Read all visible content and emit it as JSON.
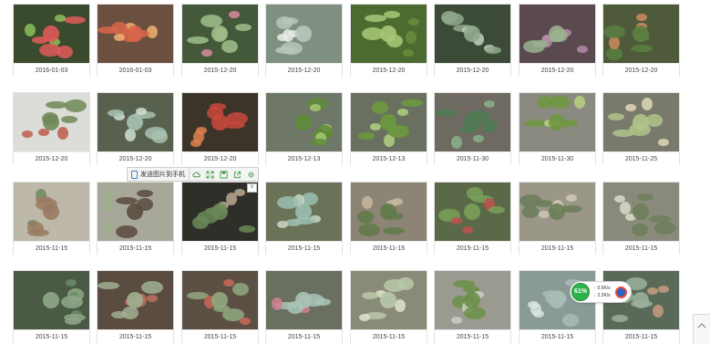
{
  "photos": [
    {
      "date": "2016-01-03",
      "bg": "#3a4a2c",
      "plant": "#e05a5a",
      "accent": "#8bbf5a"
    },
    {
      "date": "2016-01-03",
      "bg": "#6b5040",
      "plant": "#d9664a",
      "accent": "#f0b070"
    },
    {
      "date": "2015-12-20",
      "bg": "#44583a",
      "plant": "#9fc08a",
      "accent": "#d98aa0"
    },
    {
      "date": "2015-12-20",
      "bg": "#7f9080",
      "plant": "#b9c7bb",
      "accent": "#e8ece8"
    },
    {
      "date": "2015-12-20",
      "bg": "#4c6b30",
      "plant": "#a8c878",
      "accent": "#6a8c3c"
    },
    {
      "date": "2015-12-20",
      "bg": "#3c4a38",
      "plant": "#8fa88c",
      "accent": "#c0d0b8"
    },
    {
      "date": "2015-12-20",
      "bg": "#5a4a50",
      "plant": "#9ab08e",
      "accent": "#b58aa8"
    },
    {
      "date": "2015-12-20",
      "bg": "#4e5a3a",
      "plant": "#5c8040",
      "accent": "#d08a60"
    },
    {
      "date": "2015-12-20",
      "bg": "#dcdcd8",
      "plant": "#6f8a58",
      "accent": "#c05a4a"
    },
    {
      "date": "2015-12-20",
      "bg": "#58604e",
      "plant": "#a9c2b2",
      "accent": "#cfe0d4"
    },
    {
      "date": "2015-12-20",
      "bg": "#3c3428",
      "plant": "#c8483c",
      "accent": "#e08050"
    },
    {
      "date": "2015-12-13",
      "bg": "#6f7868",
      "plant": "#5f8c3a",
      "accent": "#a8c870"
    },
    {
      "date": "2015-12-13",
      "bg": "#6a7060",
      "plant": "#6c9a3c",
      "accent": "#b0d080"
    },
    {
      "date": "2015-11-30",
      "bg": "#6e6a62",
      "plant": "#4f7a52",
      "accent": "#8bb08a"
    },
    {
      "date": "2015-11-30",
      "bg": "#8a8a80",
      "plant": "#6f9640",
      "accent": "#b8d080"
    },
    {
      "date": "2015-11-25",
      "bg": "#7a7a6c",
      "plant": "#b0c48a",
      "accent": "#e0d8b8"
    },
    {
      "date": "2015-11-15",
      "bg": "#bdb8aa",
      "plant": "#9a7a62",
      "accent": "#6f8a60"
    },
    {
      "date": "2015-11-15",
      "bg": "#a8a89a",
      "plant": "#5a4a40",
      "accent": "#9db08a"
    },
    {
      "date": "2015-11-15",
      "bg": "#2f2f2a",
      "plant": "#6b8a58",
      "accent": "#b8a890"
    },
    {
      "date": "2015-11-15",
      "bg": "#6a7258",
      "plant": "#9bbfb0",
      "accent": "#c8d8c8"
    },
    {
      "date": "2015-11-15",
      "bg": "#8c8474",
      "plant": "#5f7a48",
      "accent": "#c8b8a0"
    },
    {
      "date": "2015-11-15",
      "bg": "#5a6a48",
      "plant": "#7aa05a",
      "accent": "#c05050"
    },
    {
      "date": "2015-11-15",
      "bg": "#9a9688",
      "plant": "#6a7c58",
      "accent": "#d0c8b8"
    },
    {
      "date": "2015-11-15",
      "bg": "#8a8a7c",
      "plant": "#6c7e5a",
      "accent": "#d8d8cc"
    },
    {
      "date": "2015-11-15",
      "bg": "#4a5a44",
      "plant": "#8fa888",
      "accent": "#6b8c66"
    },
    {
      "date": "2015-11-15",
      "bg": "#5a4c40",
      "plant": "#a0b090",
      "accent": "#c07060"
    },
    {
      "date": "2015-11-15",
      "bg": "#5c5044",
      "plant": "#90a880",
      "accent": "#c86858"
    },
    {
      "date": "2015-11-15",
      "bg": "#6a7060",
      "plant": "#a8c4b8",
      "accent": "#d08090"
    },
    {
      "date": "2015-11-15",
      "bg": "#8a8a78",
      "plant": "#b8c8a8",
      "accent": "#e0e0d0"
    },
    {
      "date": "2015-11-15",
      "bg": "#9a9a90",
      "plant": "#6a9048",
      "accent": "#c8d0c0"
    },
    {
      "date": "2015-11-15",
      "bg": "#8a9a94",
      "plant": "#a8bcb8",
      "accent": "#d8e4e0"
    },
    {
      "date": "2015-11-15",
      "bg": "#5a6a58",
      "plant": "#9ab09a",
      "accent": "#c89a80"
    }
  ],
  "toolbar": {
    "send_label": "发送图片到手机",
    "icons": [
      "cloud-icon",
      "expand-icon",
      "save-icon",
      "share-icon",
      "settings-icon"
    ]
  },
  "chevron": "˅",
  "speed": {
    "percent": "61%",
    "up": "0.9K/s",
    "down": "2.3K/s"
  },
  "colors": {
    "accent_green": "#2db34a",
    "toolbar_icon": "#3b9a3b"
  }
}
